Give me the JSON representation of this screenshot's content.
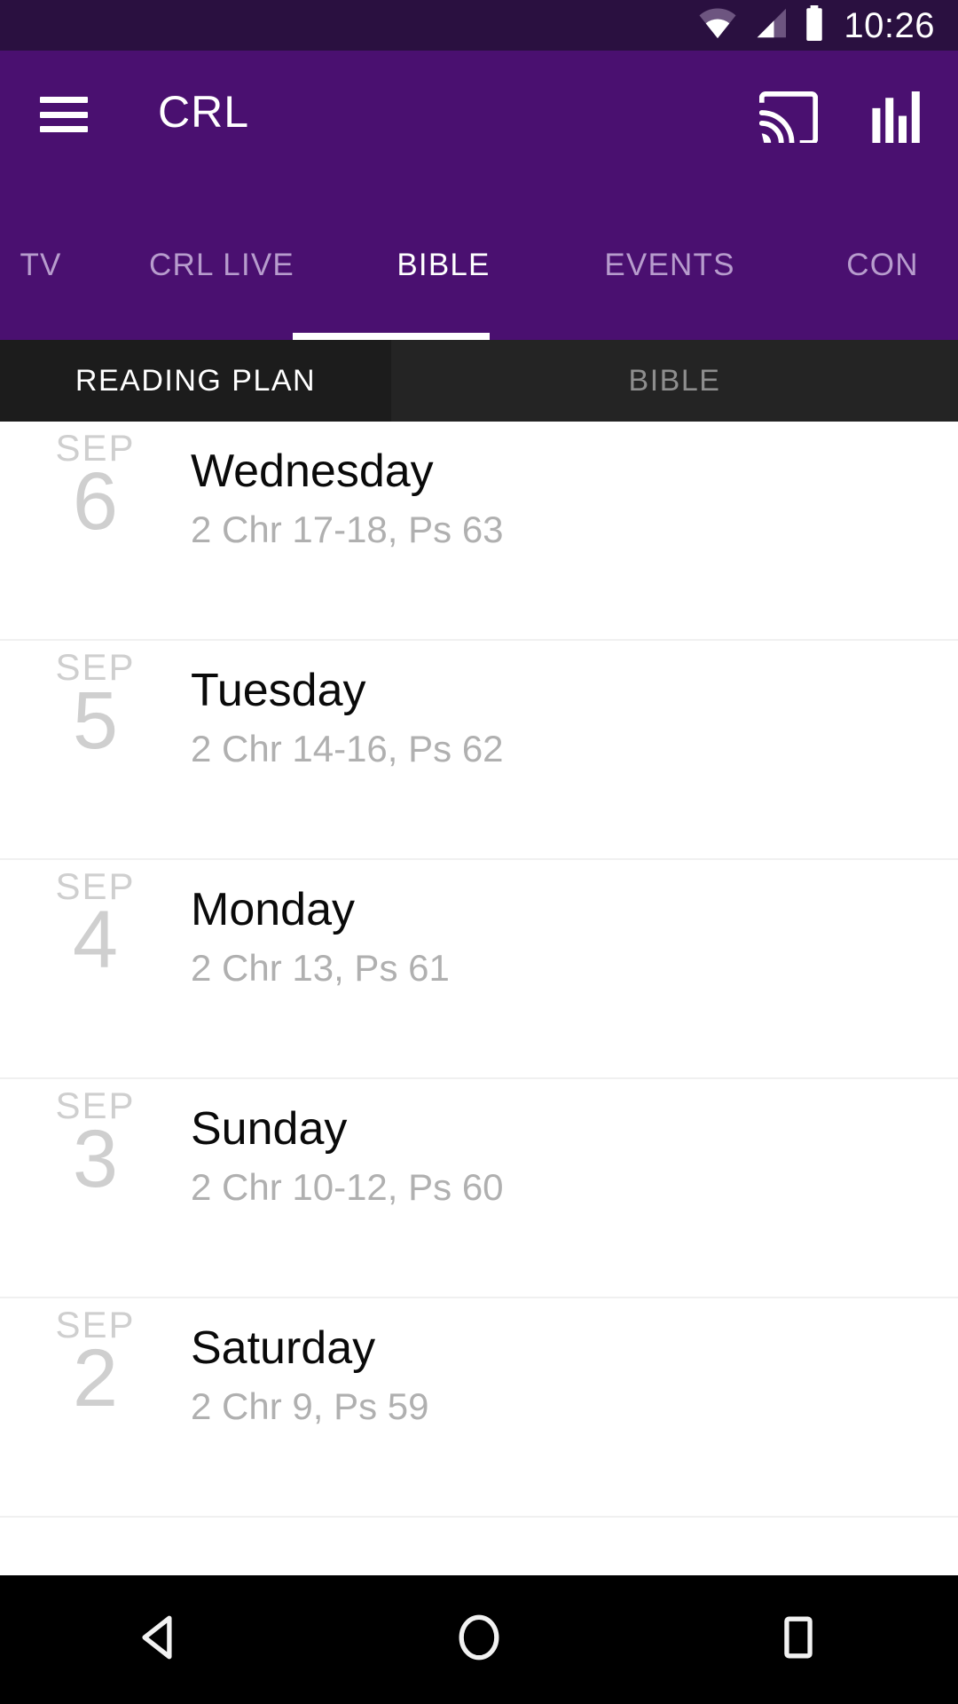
{
  "status_bar": {
    "time": "10:26",
    "icons": [
      "wifi-icon",
      "cellular-signal-icon",
      "battery-icon"
    ]
  },
  "app_bar": {
    "menu_icon": "hamburger-menu-icon",
    "title": "CRL",
    "actions": [
      {
        "icon": "cast-icon"
      },
      {
        "icon": "equalizer-icon"
      }
    ]
  },
  "primary_tabs": {
    "items": [
      {
        "label": "TV",
        "active": false
      },
      {
        "label": "CRL LIVE",
        "active": false
      },
      {
        "label": "BIBLE",
        "active": true
      },
      {
        "label": "EVENTS",
        "active": false
      },
      {
        "label": "CON",
        "active": false
      }
    ]
  },
  "secondary_tabs": {
    "items": [
      {
        "label": "READING PLAN",
        "selected": true
      },
      {
        "label": "BIBLE",
        "selected": false
      }
    ]
  },
  "reading_plan": {
    "entries": [
      {
        "month": "SEP",
        "day": "6",
        "weekday": "Wednesday",
        "passage": "2 Chr 17-18, Ps 63"
      },
      {
        "month": "SEP",
        "day": "5",
        "weekday": "Tuesday",
        "passage": "2 Chr 14-16, Ps 62"
      },
      {
        "month": "SEP",
        "day": "4",
        "weekday": "Monday",
        "passage": "2 Chr 13, Ps 61"
      },
      {
        "month": "SEP",
        "day": "3",
        "weekday": "Sunday",
        "passage": "2 Chr 10-12, Ps 60"
      },
      {
        "month": "SEP",
        "day": "2",
        "weekday": "Saturday",
        "passage": "2 Chr 9, Ps 59"
      }
    ]
  },
  "nav_bar": {
    "buttons": [
      {
        "icon": "back-triangle-icon"
      },
      {
        "icon": "home-circle-icon"
      },
      {
        "icon": "recents-square-icon"
      }
    ]
  },
  "colors": {
    "status_bar_bg": "#2a1040",
    "app_bar_bg": "#4a1070",
    "accent_white": "#ffffff",
    "subtab_selected_bg": "#1c1c1c",
    "subtab_unselected_bg": "#242424",
    "list_bg": "#ffffff",
    "nav_bar_bg": "#000000"
  }
}
